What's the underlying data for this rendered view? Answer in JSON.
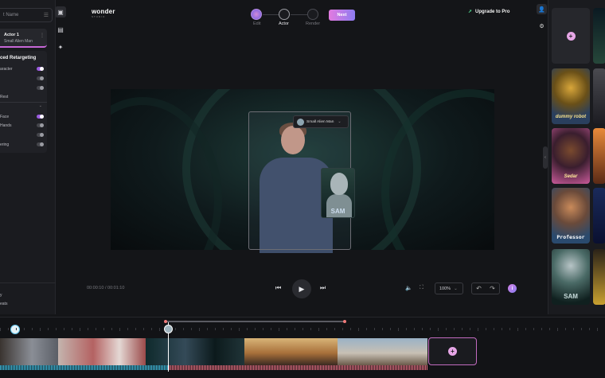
{
  "header": {
    "logo": "wonder",
    "logo_sub": "STUDIO",
    "steps": [
      {
        "label": "Edit",
        "state": "done"
      },
      {
        "label": "Actor",
        "state": "active"
      },
      {
        "label": "Render",
        "state": "pending"
      }
    ],
    "next_label": "Next",
    "upgrade_label": "Upgrade to Pro"
  },
  "left_panel": {
    "search_placeholder": "t Name",
    "actor_card": {
      "title": "Actor 1",
      "subtitle": "Small Alien Man"
    },
    "section_title": "ced Retargeting",
    "options": [
      {
        "label": "aracter",
        "on": true
      },
      {
        "label": "",
        "on": false
      },
      {
        "label": "",
        "on": false
      },
      {
        "label": "Rest",
        "on": false
      },
      {
        "label": "Face",
        "on": true
      },
      {
        "label": "Hands",
        "on": false
      },
      {
        "label": "",
        "on": false
      },
      {
        "label": "ering",
        "on": false
      }
    ],
    "bottom_items": [
      "y",
      "eats"
    ]
  },
  "canvas": {
    "actor_dropdown": "Small Alien Man",
    "alien_thumb_label": "SAM"
  },
  "player": {
    "current_time": "00:00:10",
    "total_time": "00:01:10",
    "time_separator": "/",
    "zoom": "100%"
  },
  "right_panel": {
    "characters": [
      {
        "label": "",
        "kind": "add"
      },
      {
        "label": "dummy robot",
        "kind": "robot"
      },
      {
        "label": "Sedar",
        "kind": "girl"
      },
      {
        "label": "Professor",
        "kind": "professor"
      },
      {
        "label": "SAM",
        "kind": "alien"
      }
    ]
  },
  "timeline": {
    "clips": [
      {
        "name": "clip-1",
        "color1": "#5a4e45",
        "color2": "#8a8e96"
      },
      {
        "name": "clip-2",
        "color1": "#b46262",
        "color2": "#ececf0"
      },
      {
        "name": "clip-3",
        "color1": "#0f2a2c",
        "color2": "#344a58"
      },
      {
        "name": "clip-4",
        "color1": "#c89a58",
        "color2": "#4a3a2e"
      },
      {
        "name": "clip-5",
        "color1": "#9ab2c6",
        "color2": "#d8c8b0"
      }
    ]
  },
  "colors": {
    "accent": "#c667d6",
    "accent2": "#8d7bf0",
    "toggle_on": "#9c5de0"
  }
}
